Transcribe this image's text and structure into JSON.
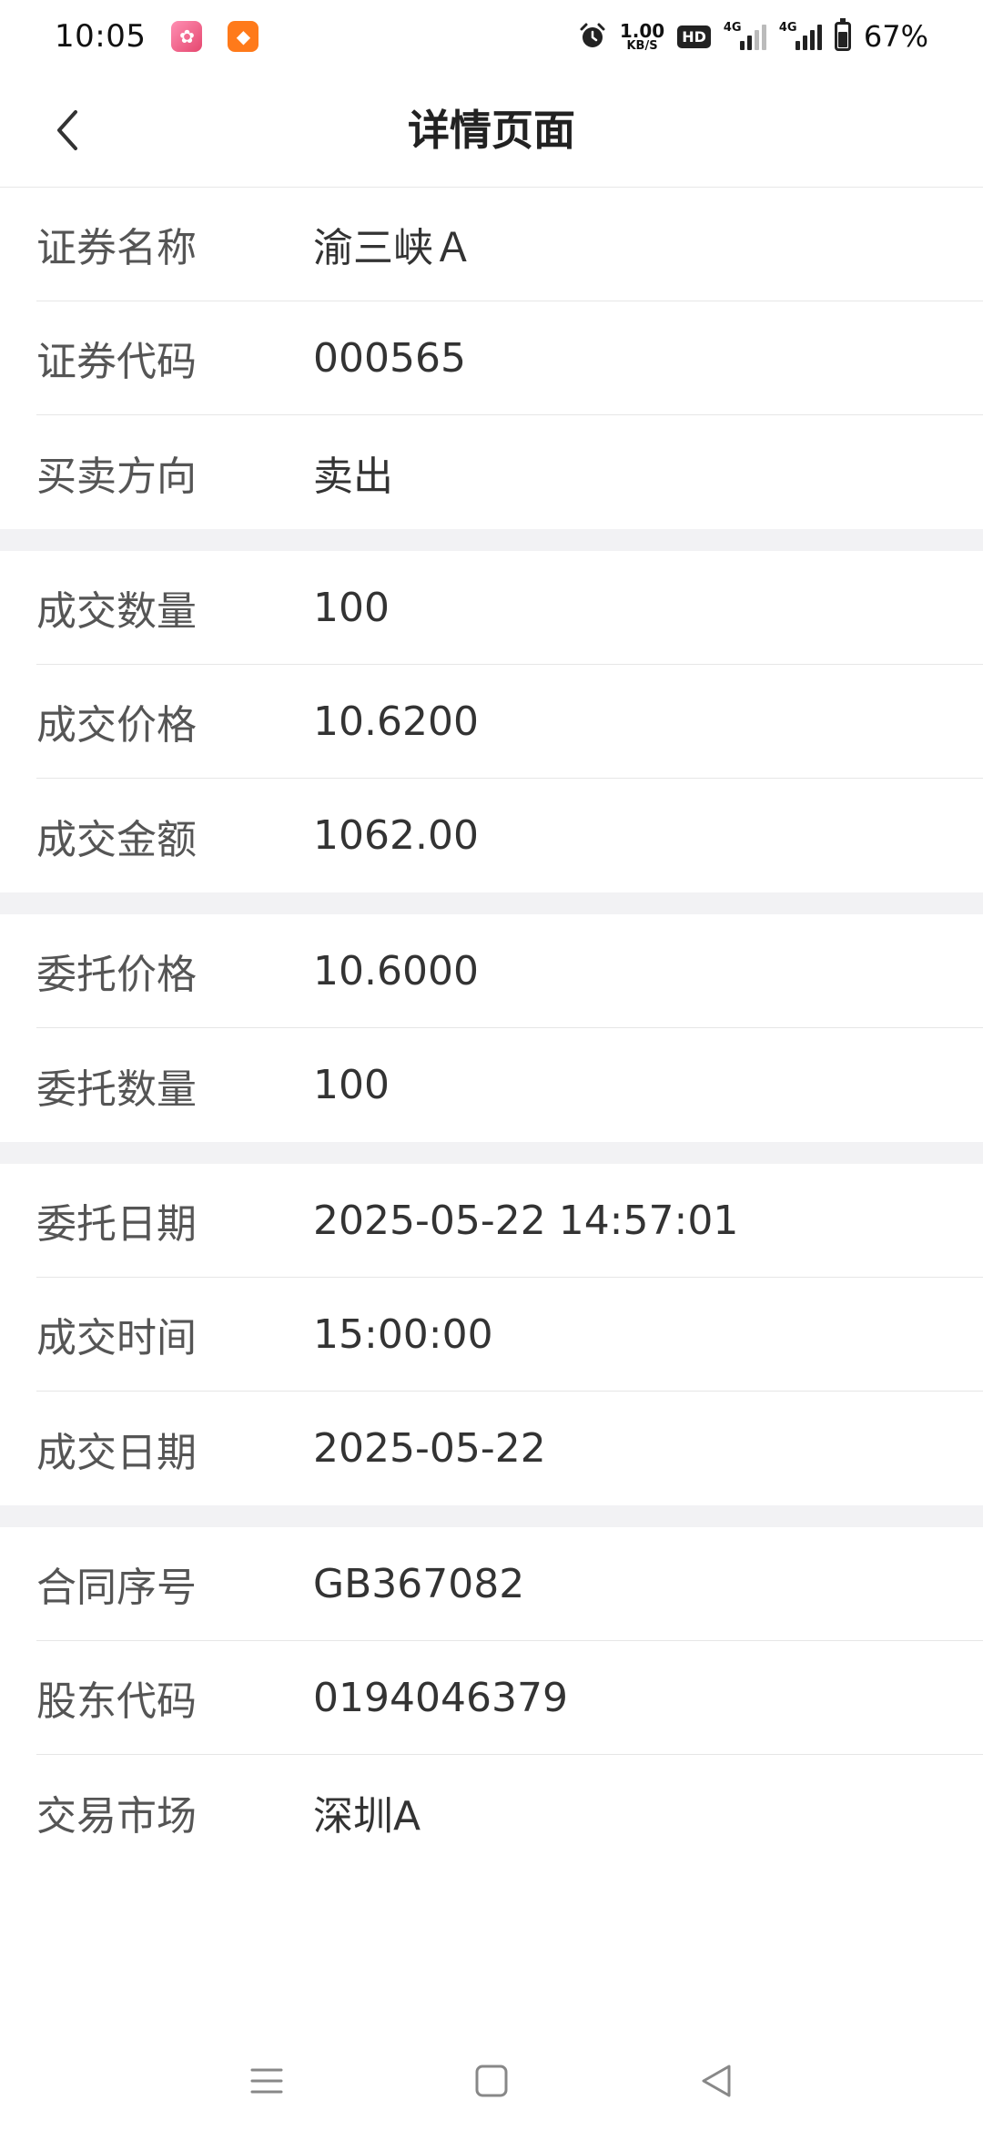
{
  "status_bar": {
    "time": "10:05",
    "net_speed_value": "1.00",
    "net_speed_unit": "KB/S",
    "hd_label": "HD",
    "network_type_1": "4G",
    "network_type_2": "4G",
    "battery_percent": "67%",
    "battery_level": 0.67
  },
  "header": {
    "title": "详情页面",
    "back_icon": "chevron-left-icon"
  },
  "sections": [
    {
      "rows": [
        {
          "label": "证券名称",
          "value": "渝三峡Ａ"
        },
        {
          "label": "证券代码",
          "value": "000565"
        },
        {
          "label": "买卖方向",
          "value": "卖出"
        }
      ]
    },
    {
      "rows": [
        {
          "label": "成交数量",
          "value": "100"
        },
        {
          "label": "成交价格",
          "value": "10.6200"
        },
        {
          "label": "成交金额",
          "value": "1062.00"
        }
      ]
    },
    {
      "rows": [
        {
          "label": "委托价格",
          "value": "10.6000"
        },
        {
          "label": "委托数量",
          "value": "100"
        }
      ]
    },
    {
      "rows": [
        {
          "label": "委托日期",
          "value": "2025-05-22 14:57:01"
        },
        {
          "label": "成交时间",
          "value": "15:00:00"
        },
        {
          "label": "成交日期",
          "value": "2025-05-22"
        }
      ]
    },
    {
      "rows": [
        {
          "label": "合同序号",
          "value": "GB367082"
        },
        {
          "label": "股东代码",
          "value": "0194046379"
        },
        {
          "label": "交易市场",
          "value": "深圳A"
        }
      ]
    }
  ],
  "colors": {
    "divider": "#e6e6e6",
    "section_gap": "#f2f2f4",
    "label_text": "#555555",
    "value_text": "#333333"
  },
  "system_nav": [
    "menu-icon",
    "home-icon",
    "back-triangle-icon"
  ]
}
